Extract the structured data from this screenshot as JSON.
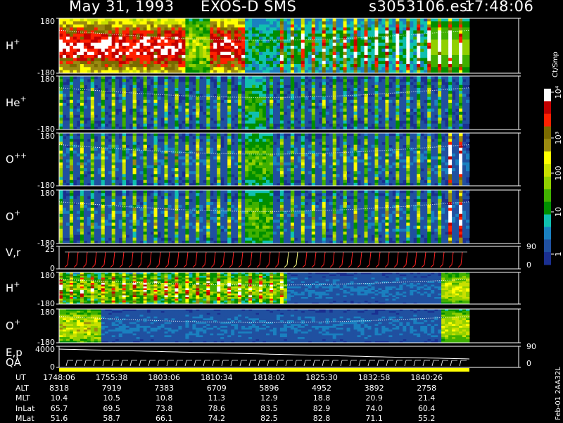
{
  "header": {
    "date": "May 31, 1993",
    "instrument": "EXOS-D SMS",
    "file": "s3053106.esr",
    "time": "17:48:06"
  },
  "colorbar": {
    "unit_label": "Ct/Smp",
    "tick_labels": [
      "10⁴",
      "10³",
      "100",
      "10",
      "1"
    ],
    "colors": [
      "#ffffff",
      "#c00000",
      "#ff2000",
      "#7a6a00",
      "#9a8a10",
      "#ffff00",
      "#c8e000",
      "#90d000",
      "#40b000",
      "#008f00",
      "#10c0b0",
      "#1a80c0",
      "#2050a0",
      "#1a2f90"
    ]
  },
  "chart_data": [
    {
      "type": "heatmap",
      "panel": "H+",
      "label": "H",
      "ion_sup": "+",
      "ylim": [
        -180,
        180
      ],
      "tick_labels": [
        "180",
        "-180"
      ],
      "dominant_levels": "high (yellow-green) early, decreasing later"
    },
    {
      "type": "heatmap",
      "panel": "He+",
      "label": "He",
      "ion_sup": "+",
      "ylim": [
        -180,
        180
      ],
      "tick_labels": [
        "180",
        "-180"
      ]
    },
    {
      "type": "heatmap",
      "panel": "O++",
      "label": "O",
      "ion_sup": "++",
      "ylim": [
        -180,
        180
      ],
      "tick_labels": [
        "180",
        "-180"
      ]
    },
    {
      "type": "heatmap",
      "panel": "O+",
      "label": "O",
      "ion_sup": "+",
      "ylim": [
        -180,
        180
      ],
      "tick_labels": [
        "180",
        "-180"
      ]
    },
    {
      "type": "line",
      "panel": "V,r",
      "label": "V,r",
      "ylim": [
        0,
        25
      ],
      "tick_labels": [
        "25",
        "0"
      ],
      "right_tick_labels": [
        "90",
        "0"
      ]
    },
    {
      "type": "heatmap",
      "panel": "H+ (2)",
      "label": "H",
      "ion_sup": "+",
      "ylim": [
        -180,
        180
      ],
      "tick_labels": [
        "180",
        "-180"
      ]
    },
    {
      "type": "heatmap",
      "panel": "O+ (2)",
      "label": "O",
      "ion_sup": "+",
      "ylim": [
        -180,
        180
      ],
      "tick_labels": [
        "180",
        "-180"
      ]
    },
    {
      "type": "line",
      "panel": "E,p / QA",
      "label": "E,p",
      "label2": "QA",
      "ylim": [
        0,
        4000
      ],
      "tick_labels": [
        "4000",
        "0"
      ],
      "right_tick_labels": [
        "90",
        "0"
      ]
    }
  ],
  "footer": {
    "row_labels": [
      "UT",
      "ALT",
      "MLT",
      "InLat",
      "MLat"
    ],
    "columns": [
      {
        "UT": "1748:06",
        "ALT": "8318",
        "MLT": "10.4",
        "InLat": "65.7",
        "MLat": "51.6"
      },
      {
        "UT": "1755:38",
        "ALT": "7919",
        "MLT": "10.5",
        "InLat": "69.5",
        "MLat": "58.7"
      },
      {
        "UT": "1803:06",
        "ALT": "7383",
        "MLT": "10.8",
        "InLat": "73.8",
        "MLat": "66.1"
      },
      {
        "UT": "1810:34",
        "ALT": "6709",
        "MLT": "11.3",
        "InLat": "78.6",
        "MLat": "74.2"
      },
      {
        "UT": "1818:02",
        "ALT": "5896",
        "MLT": "12.9",
        "InLat": "83.5",
        "MLat": "82.5"
      },
      {
        "UT": "1825:30",
        "ALT": "4952",
        "MLT": "18.8",
        "InLat": "82.9",
        "MLat": "82.8"
      },
      {
        "UT": "1832:58",
        "ALT": "3892",
        "MLT": "20.9",
        "InLat": "74.0",
        "MLat": "71.1"
      },
      {
        "UT": "1840:26",
        "ALT": "2758",
        "MLT": "21.4",
        "InLat": "60.4",
        "MLat": "55.2"
      }
    ]
  },
  "side_note": "Feb-01 2AA32L"
}
